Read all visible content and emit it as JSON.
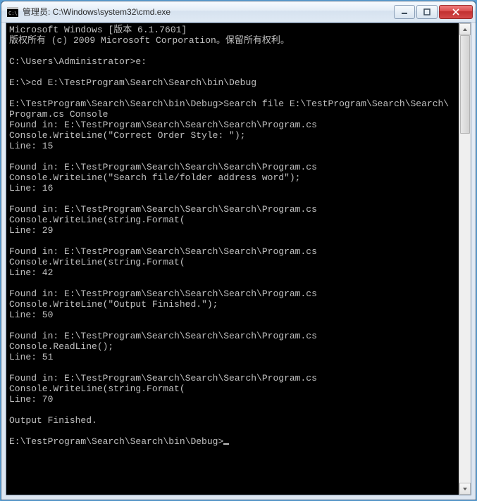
{
  "title": "管理员: C:\\Windows\\system32\\cmd.exe",
  "icon_glyph": "C:\\",
  "controls": {
    "min": "—",
    "max": "▢",
    "close": "✕"
  },
  "lines": [
    "Microsoft Windows [版本 6.1.7601]",
    "版权所有 (c) 2009 Microsoft Corporation。保留所有权利。",
    "",
    "C:\\Users\\Administrator>e:",
    "",
    "E:\\>cd E:\\TestProgram\\Search\\Search\\bin\\Debug",
    "",
    "E:\\TestProgram\\Search\\Search\\bin\\Debug>Search file E:\\TestProgram\\Search\\Search\\",
    "Program.cs Console",
    "Found in: E:\\TestProgram\\Search\\Search\\Search\\Program.cs",
    "Console.WriteLine(\"Correct Order Style: \");",
    "Line: 15",
    "",
    "Found in: E:\\TestProgram\\Search\\Search\\Search\\Program.cs",
    "Console.WriteLine(\"Search file/folder address word\");",
    "Line: 16",
    "",
    "Found in: E:\\TestProgram\\Search\\Search\\Search\\Program.cs",
    "Console.WriteLine(string.Format(",
    "Line: 29",
    "",
    "Found in: E:\\TestProgram\\Search\\Search\\Search\\Program.cs",
    "Console.WriteLine(string.Format(",
    "Line: 42",
    "",
    "Found in: E:\\TestProgram\\Search\\Search\\Search\\Program.cs",
    "Console.WriteLine(\"Output Finished.\");",
    "Line: 50",
    "",
    "Found in: E:\\TestProgram\\Search\\Search\\Search\\Program.cs",
    "Console.ReadLine();",
    "Line: 51",
    "",
    "Found in: E:\\TestProgram\\Search\\Search\\Search\\Program.cs",
    "Console.WriteLine(string.Format(",
    "Line: 70",
    "",
    "Output Finished.",
    "",
    "E:\\TestProgram\\Search\\Search\\bin\\Debug>"
  ]
}
